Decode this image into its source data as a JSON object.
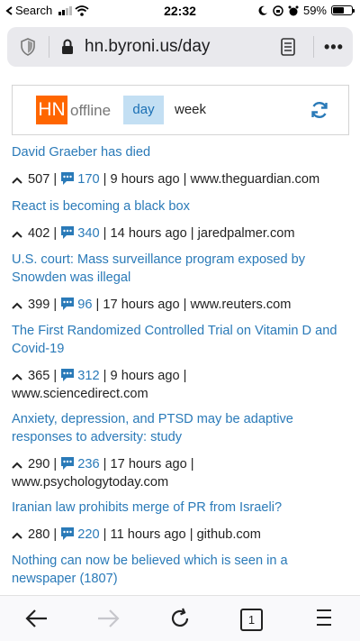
{
  "status_bar": {
    "carrier": "Search",
    "time": "22:32",
    "battery_percent": "59%",
    "battery_level": 0.59
  },
  "address_bar": {
    "url": "hn.byroni.us/day",
    "menu_label": "•••"
  },
  "hn_header": {
    "logo": "HN",
    "offline_label": "offline",
    "tabs": [
      {
        "label": "day",
        "active": true
      },
      {
        "label": "week",
        "active": false
      }
    ],
    "logo_color": "#ff6600",
    "active_tab_color": "#c3dff3"
  },
  "stories": [
    {
      "title": "David Graeber has died",
      "points": "507",
      "comments": "170",
      "age": "9 hours ago",
      "domain": "www.theguardian.com"
    },
    {
      "title": "React is becoming a black box",
      "points": "402",
      "comments": "340",
      "age": "14 hours ago",
      "domain": "jaredpalmer.com"
    },
    {
      "title": "U.S. court: Mass surveillance program exposed by Snowden was illegal",
      "points": "399",
      "comments": "96",
      "age": "17 hours ago",
      "domain": "www.reuters.com"
    },
    {
      "title": "The First Randomized Controlled Trial on Vitamin D and Covid-19",
      "points": "365",
      "comments": "312",
      "age": "9 hours ago",
      "domain": "www.sciencedirect.com"
    },
    {
      "title": "Anxiety, depression, and PTSD may be adaptive responses to adversity: study",
      "points": "290",
      "comments": "236",
      "age": "17 hours ago",
      "domain": "www.psychologytoday.com"
    },
    {
      "title": "Iranian law prohibits merge of PR from Israeli?",
      "points": "280",
      "comments": "220",
      "age": "11 hours ago",
      "domain": "github.com"
    },
    {
      "title": "Nothing can now be believed which is seen in a newspaper (1807)"
    }
  ],
  "toolbar": {
    "tab_count": "1"
  },
  "colors": {
    "link": "#2a7ab8",
    "accent": "#ff6600"
  }
}
